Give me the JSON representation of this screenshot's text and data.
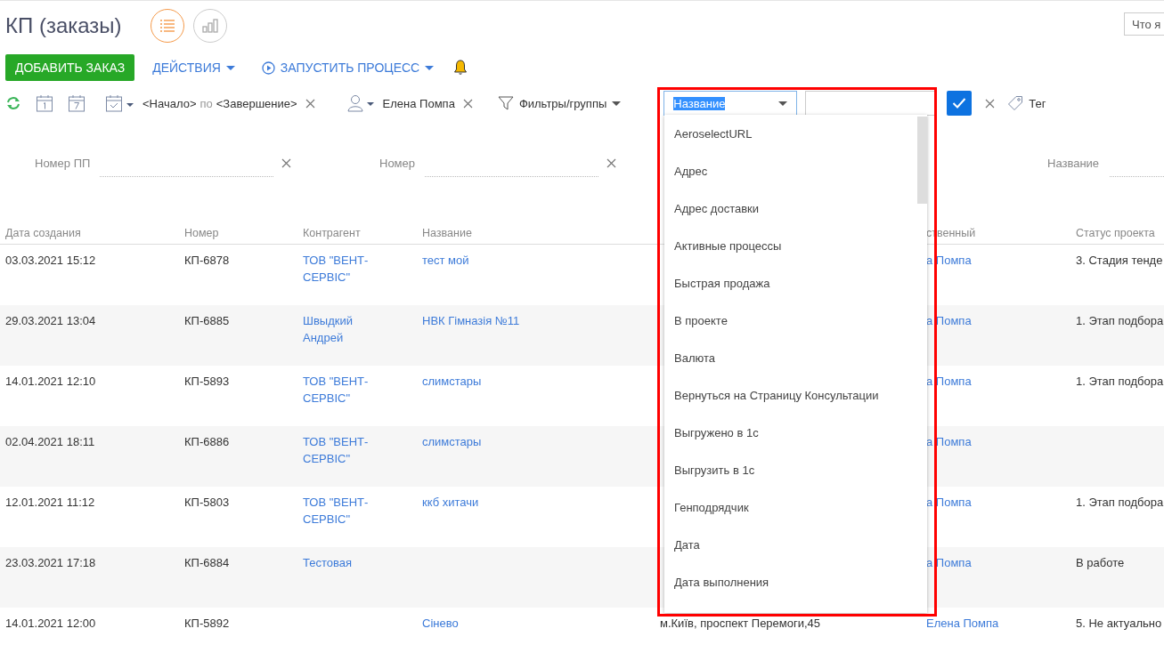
{
  "page": {
    "title": "КП (заказы)",
    "view_buttons": [
      {
        "kind": "list",
        "selected": true
      },
      {
        "kind": "chart",
        "selected": false
      }
    ],
    "search": {
      "placeholder": "Что я"
    }
  },
  "actions": {
    "primary": "ДОБАВИТЬ ЗАКАЗ",
    "menu": "ДЕЙСТВИЯ",
    "process": "ЗАПУСТИТЬ ПРОЦЕСС"
  },
  "filter_bar": {
    "period_start": "<Начало>",
    "period_joiner": "по",
    "period_end": "<Завершение>",
    "owner": "Елена Помпа",
    "filters_label": "Фильтры/группы",
    "tag_label": "Тег",
    "field_select": {
      "value": "Название",
      "options": [
        "AeroselectURL",
        "Адрес",
        "Адрес доставки",
        "Активные процессы",
        "Быстрая продажа",
        "В проекте",
        "Валюта",
        "Вернуться на Страницу Консультации",
        "Выгружено в 1с",
        "Выгрузить в 1с",
        "Генподрядчик",
        "Дата",
        "Дата выполнения"
      ]
    }
  },
  "quick_filters": [
    {
      "placeholder": "Номер ПП",
      "kind": "clearable"
    },
    {
      "placeholder": "Номер",
      "kind": "clearable"
    },
    {
      "placeholder": "Название",
      "kind": "search"
    }
  ],
  "table": {
    "columns": {
      "date": "Дата создания",
      "number": "Номер",
      "contractor": "Контрагент",
      "name": "Название",
      "responsible": "ственный",
      "status": "Статус проекта"
    },
    "rows": [
      {
        "date": "03.03.2021 15:12",
        "number": "КП-6878",
        "contractor": "ТОВ \"ВЕНТ-СЕРВІС\"",
        "name": "тест мой",
        "responsible": "а Помпа",
        "status": "3. Стадия тенде"
      },
      {
        "date": "29.03.2021 13:04",
        "number": "КП-6885",
        "contractor": "Швыдкий Андрей",
        "name": "НВК Гімназія №11",
        "responsible": "а Помпа",
        "status": "1. Этап подбора"
      },
      {
        "date": "14.01.2021 12:10",
        "number": "КП-5893",
        "contractor": "ТОВ \"ВЕНТ-СЕРВІС\"",
        "name": "слимстары",
        "responsible": "а Помпа",
        "status": "1. Этап подбора"
      },
      {
        "date": "02.04.2021 18:11",
        "number": "КП-6886",
        "contractor": "ТОВ \"ВЕНТ-СЕРВІС\"",
        "name": "слимстары",
        "responsible": "а Помпа"
      },
      {
        "date": "12.01.2021 11:12",
        "number": "КП-5803",
        "contractor": "ТОВ \"ВЕНТ-СЕРВІС\"",
        "name": "ккб хитачи",
        "responsible": "а Помпа",
        "status": "1. Этап подбора"
      },
      {
        "date": "23.03.2021 17:18",
        "number": "КП-6884",
        "contractor": "Тестовая",
        "responsible": "а Помпа",
        "status": "В работе"
      },
      {
        "date": "14.01.2021 12:00",
        "number": "КП-5892",
        "name": "Сінево",
        "address": "м.Київ, проспект Перемоги,45",
        "responsible": "Елена Помпа",
        "status": "5. Не актуально"
      }
    ]
  }
}
